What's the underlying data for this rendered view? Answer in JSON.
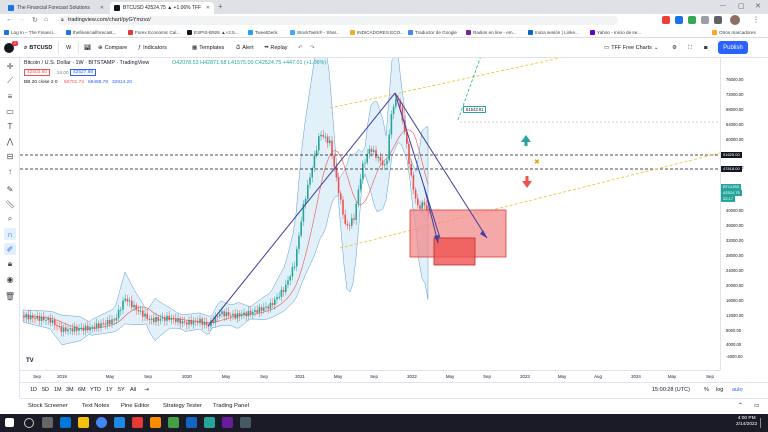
{
  "browser": {
    "tabs": [
      {
        "title": "The Financial Forecast Solutions",
        "active": false,
        "color": "#1a73e8"
      },
      {
        "title": "BTCUSD 42524.75 ▲ +1.06% TFF",
        "active": true,
        "color": "#131722"
      }
    ],
    "new_tab": "+",
    "url": "tradingview.com/chart/pyGYmzvz/",
    "bookmarks": [
      {
        "label": "Log In – The Financi...",
        "color": "#1a73e8"
      },
      {
        "label": "thefinancialforecast...",
        "color": "#1a73e8"
      },
      {
        "label": "Forex Economic Cal...",
        "color": "#e53935"
      },
      {
        "label": "ESPIS-B926 ▲+2.5...",
        "color": "#131722"
      },
      {
        "label": "TweetDeck",
        "color": "#1da1f2"
      },
      {
        "label": "StockTwits® - Shar...",
        "color": "#40a9ff"
      },
      {
        "label": "INDICADORES ECO...",
        "color": "#f9a825"
      },
      {
        "label": "Traductor de Google",
        "color": "#4285f4"
      },
      {
        "label": "Radios en line - em...",
        "color": "#7b1fa2"
      },
      {
        "label": "Inicia sesión | Linke...",
        "color": "#0a66c2"
      },
      {
        "label": "Yahoo - Inicio de se...",
        "color": "#6001d2"
      }
    ],
    "other_bookmarks": "Otros marcadores"
  },
  "toolbar": {
    "symbol": "BTCUSD",
    "interval": "W",
    "compare": "Compare",
    "indicators": "Indicators",
    "templates": "Templates",
    "alert": "Alert",
    "replay": "Replay",
    "layout_name": "TFF Free Charts",
    "publish": "Publish"
  },
  "legend": {
    "title": "Bitcoin / U.S. Dollar · 1W · BITSTAMP · TradingView",
    "ohlc": "O42078.53 H42871.68 L41575.00 C42524.75 +447.01 (+1.06%)",
    "bid": "42503.60",
    "spread": "24.00",
    "ask": "42527.86",
    "bb_label": "BB 20 close 2 0",
    "bb_values": [
      "50701.73",
      "68488.78",
      "32914.20"
    ]
  },
  "price_axis": {
    "labels": [
      "76000.00",
      "72000.00",
      "68000.00",
      "64000.00",
      "60000.00",
      "56000.00",
      "52000.00",
      "48000.00",
      "44000.00",
      "40000.00",
      "36000.00",
      "32000.00",
      "28000.00",
      "24000.00",
      "20000.00",
      "16000.00",
      "12000.00",
      "8000.00",
      "4000.00",
      "0.00",
      "-4000.00"
    ],
    "tags": [
      {
        "text": "51625.00",
        "color": "#131722"
      },
      {
        "text": "47818.00",
        "color": "#131722"
      },
      {
        "text": "BTCUSD",
        "color": "#26a69a"
      },
      {
        "text": "42524.75",
        "color": "#26a69a"
      },
      {
        "text": "32:17",
        "color": "#26a69a"
      }
    ]
  },
  "chart_labels": {
    "price_callout": "61543.91",
    "tv_logo": "TV"
  },
  "time_axis": {
    "labels": [
      "Sep",
      "2019",
      "May",
      "Sep",
      "2020",
      "May",
      "Sep",
      "2021",
      "May",
      "Sep",
      "2022",
      "May",
      "Sep",
      "2023",
      "May",
      "Aug",
      "2024",
      "May",
      "Sep"
    ]
  },
  "ranges": {
    "items": [
      "1D",
      "5D",
      "1M",
      "3M",
      "6M",
      "YTD",
      "1Y",
      "5Y",
      "All"
    ],
    "clock": "15:00:28 (UTC)",
    "percent": "%",
    "log": "log",
    "auto": "auto"
  },
  "bottom_panel": {
    "tabs": [
      "Stock Screener",
      "Text Notes",
      "Pine Editor",
      "Strategy Tester",
      "Trading Panel"
    ]
  },
  "taskbar": {
    "time": "4:00 PM",
    "date": "2/14/2022"
  },
  "colors": {
    "accent": "#2962ff",
    "candle_up": "#26a69a",
    "candle_down": "#ef5350",
    "bb_fill": "#d9ecf7",
    "drawing_line": "#3f3f9e"
  }
}
